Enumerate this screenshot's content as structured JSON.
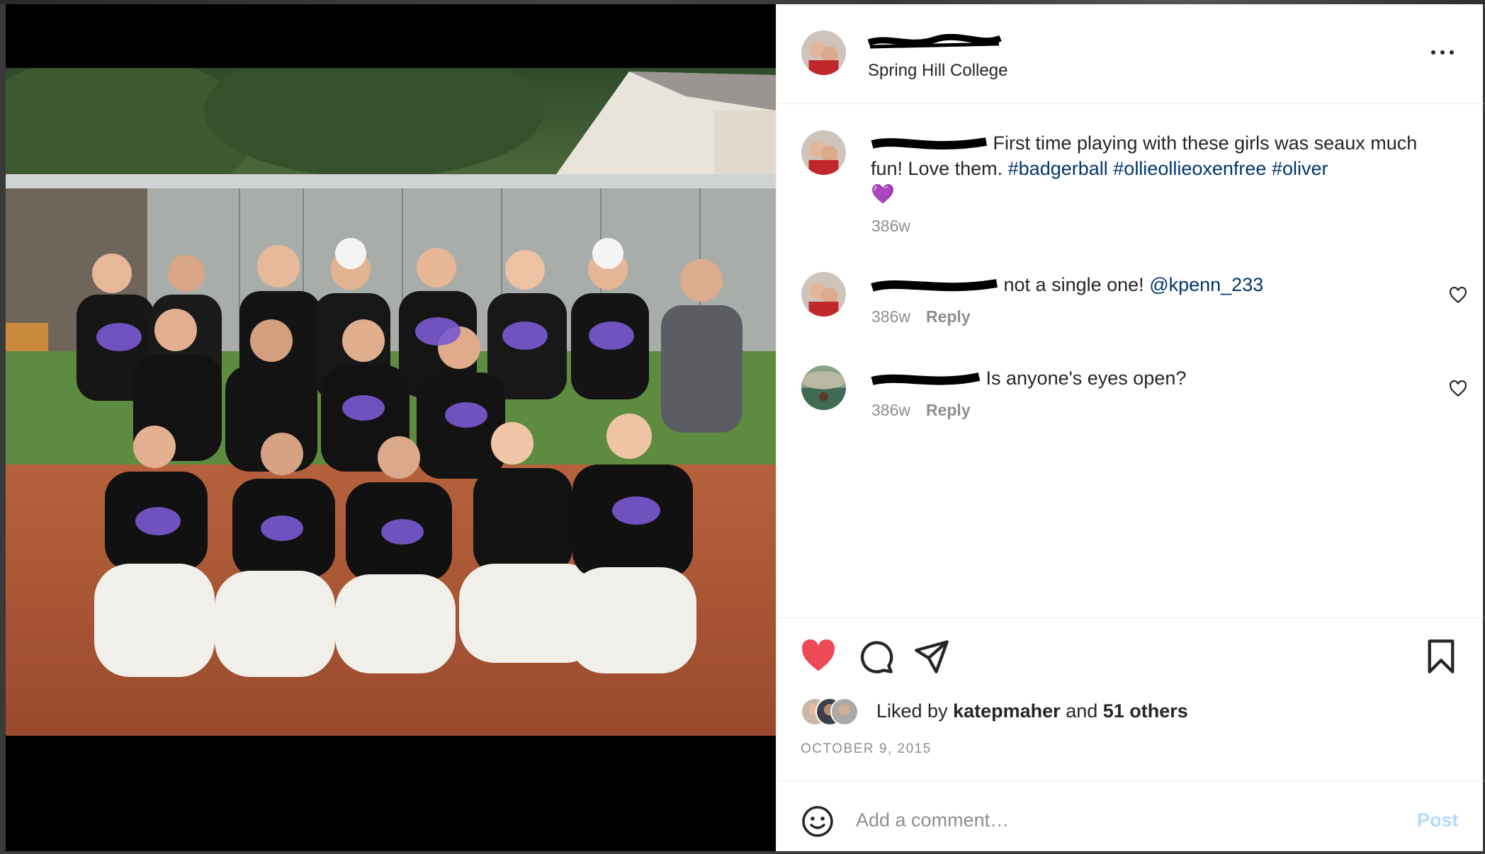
{
  "post": {
    "location": "Spring Hill College",
    "caption": {
      "text": "First time playing with these girls was seaux much fun! Love them.",
      "hashtags": [
        "#badgerball",
        "#ollieollieoxenfree",
        "#oliver"
      ],
      "emoji": "💜",
      "age": "386w"
    },
    "comments": [
      {
        "text": "not a single one!",
        "mention": "@kpenn_233",
        "age": "386w",
        "reply_label": "Reply"
      },
      {
        "text": "Is anyone's eyes open?",
        "age": "386w",
        "reply_label": "Reply"
      }
    ],
    "likes": {
      "prefix": "Liked by",
      "user": "katepmaher",
      "joiner": "and",
      "others": "51 others"
    },
    "date": "OCTOBER 9, 2015"
  },
  "composer": {
    "placeholder": "Add a comment…",
    "post_label": "Post"
  },
  "icons": {
    "more": "more-options-icon",
    "like": "heart-filled-icon",
    "comment": "comment-bubble-icon",
    "share": "paper-plane-icon",
    "save": "bookmark-icon",
    "comment_like": "heart-outline-icon",
    "emoji": "smiley-icon"
  },
  "colors": {
    "like": "#ed4956",
    "link": "#00376b",
    "post_disabled": "#b3dbff",
    "text": "#262626",
    "muted": "#8e8e8e"
  }
}
